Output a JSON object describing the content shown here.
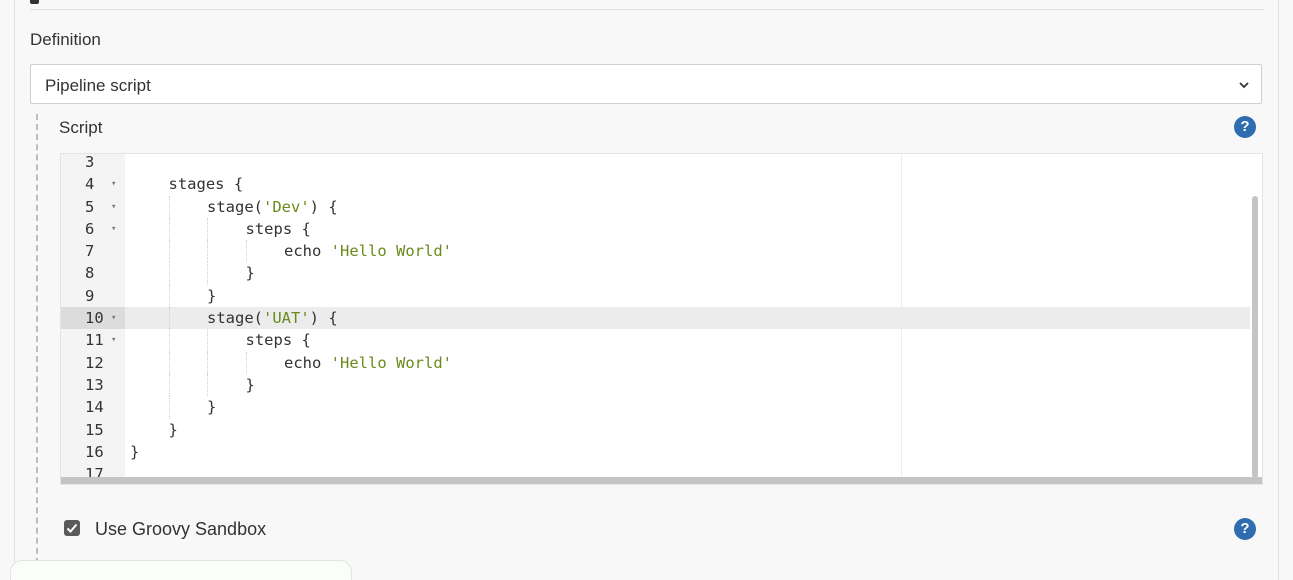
{
  "definition": {
    "label": "Definition",
    "selected": "Pipeline script"
  },
  "script": {
    "label": "Script",
    "lines": [
      {
        "number": "3",
        "indent": 0,
        "text": ""
      },
      {
        "number": "4",
        "fold": true,
        "indent": 1,
        "text": "stages {"
      },
      {
        "number": "5",
        "fold": true,
        "indent": 2,
        "text": "stage('Dev') {"
      },
      {
        "number": "6",
        "fold": true,
        "indent": 3,
        "text": "steps {"
      },
      {
        "number": "7",
        "indent": 4,
        "text": "echo 'Hello World'"
      },
      {
        "number": "8",
        "indent": 3,
        "text": "}"
      },
      {
        "number": "9",
        "indent": 2,
        "text": "}"
      },
      {
        "number": "10",
        "fold": true,
        "active": true,
        "indent": 2,
        "text": "stage('UAT') {"
      },
      {
        "number": "11",
        "fold": true,
        "indent": 3,
        "text": "steps {"
      },
      {
        "number": "12",
        "indent": 4,
        "text": "echo 'Hello World'"
      },
      {
        "number": "13",
        "indent": 3,
        "text": "}"
      },
      {
        "number": "14",
        "indent": 2,
        "text": "}"
      },
      {
        "number": "15",
        "indent": 1,
        "text": "}"
      },
      {
        "number": "16",
        "indent": 0,
        "text": "}"
      },
      {
        "number": "17",
        "indent": 0,
        "text": ""
      }
    ]
  },
  "sandbox": {
    "label": "Use Groovy Sandbox",
    "checked": true
  },
  "help": {
    "glyph": "?"
  },
  "colors": {
    "help_blue": "#2e6eb0",
    "string_green": "#6a8a1a",
    "active_line": "#ececec"
  }
}
